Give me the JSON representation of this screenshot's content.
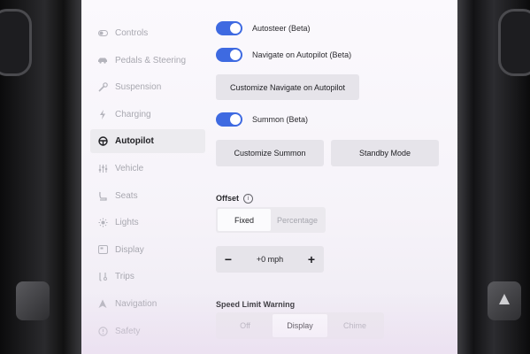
{
  "sidebar": {
    "items": [
      {
        "label": "Controls",
        "icon": "toggle-icon"
      },
      {
        "label": "Pedals & Steering",
        "icon": "car-icon"
      },
      {
        "label": "Suspension",
        "icon": "wrench-icon"
      },
      {
        "label": "Charging",
        "icon": "bolt-icon"
      },
      {
        "label": "Autopilot",
        "icon": "steering-wheel-icon",
        "active": true
      },
      {
        "label": "Vehicle",
        "icon": "sliders-icon"
      },
      {
        "label": "Seats",
        "icon": "seat-icon"
      },
      {
        "label": "Lights",
        "icon": "sun-icon"
      },
      {
        "label": "Display",
        "icon": "display-icon"
      },
      {
        "label": "Trips",
        "icon": "trips-icon"
      },
      {
        "label": "Navigation",
        "icon": "navigation-arrow-icon"
      },
      {
        "label": "Safety",
        "icon": "safety-icon"
      }
    ]
  },
  "autopilot": {
    "autosteer": {
      "label": "Autosteer (Beta)",
      "on": true
    },
    "navigate_on_autopilot": {
      "label": "Navigate on Autopilot (Beta)",
      "on": true
    },
    "customize_noa_button": "Customize Navigate on Autopilot",
    "summon": {
      "label": "Summon (Beta)",
      "on": true
    },
    "customize_summon_button": "Customize Summon",
    "standby_mode_button": "Standby Mode",
    "offset": {
      "title": "Offset",
      "info_icon": "info-icon",
      "options": [
        "Fixed",
        "Percentage"
      ],
      "selected": "Fixed",
      "value": "+0 mph",
      "decrement": "−",
      "increment": "+"
    },
    "speed_limit_warning": {
      "title": "Speed Limit Warning",
      "options": [
        "Off",
        "Display",
        "Chime"
      ],
      "selected": "Display"
    }
  },
  "colors": {
    "accent": "#3e6ae1",
    "active_bg": "#ecebef",
    "button_bg": "#e6e4ea"
  }
}
